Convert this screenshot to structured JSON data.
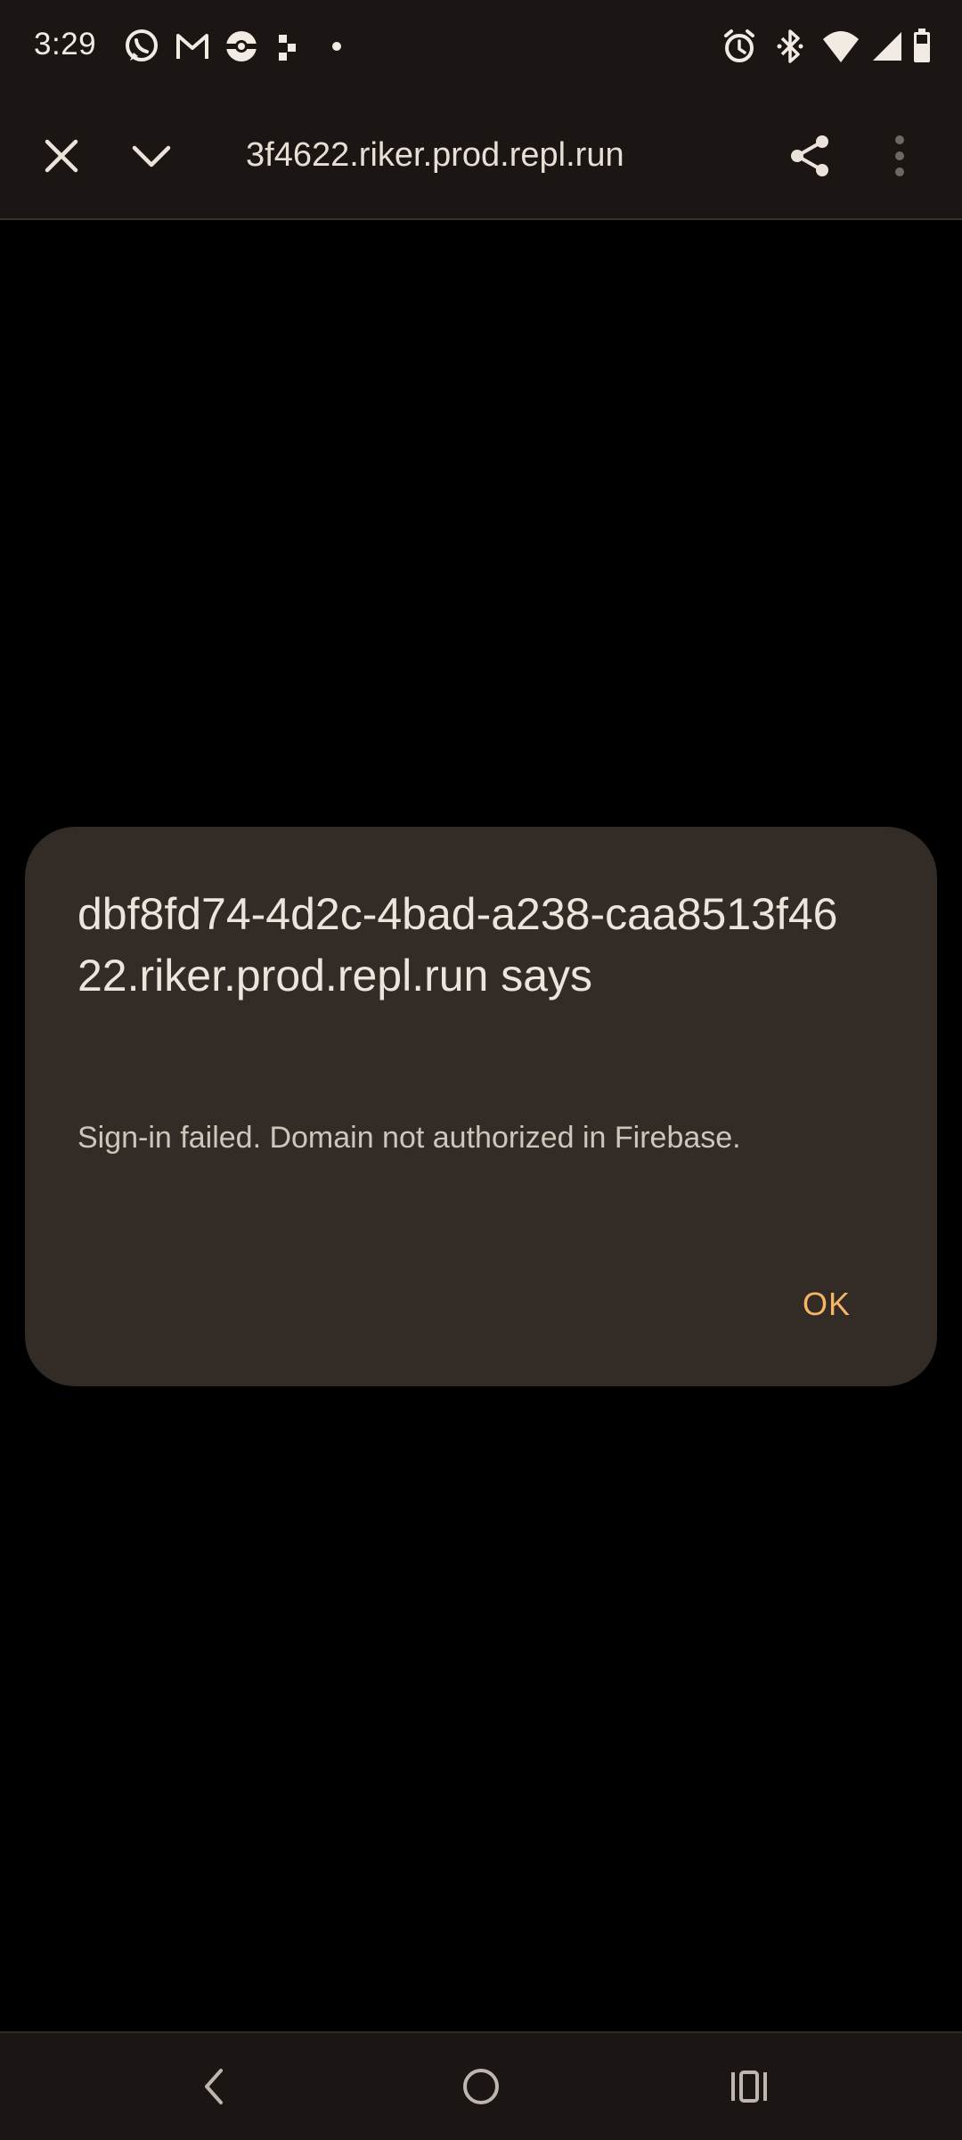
{
  "status_bar": {
    "time": "3:29",
    "left_icons": [
      "whatsapp-icon",
      "gmail-icon",
      "pokeball-icon",
      "dots-app-icon",
      "notification-dot-icon"
    ],
    "right_icons": [
      "alarm-icon",
      "bluetooth-icon",
      "wifi-icon",
      "signal-icon",
      "battery-icon"
    ]
  },
  "toolbar": {
    "url": "3f4622.riker.prod.repl.run",
    "icons": [
      "close-icon",
      "chevron-down-icon",
      "share-icon",
      "more-vert-icon"
    ]
  },
  "dialog": {
    "title": "dbf8fd74-4d2c-4bad-a238-caa8513f4622.riker.prod.repl.run says",
    "message": "Sign-in failed. Domain not authorized in Firebase.",
    "ok_label": "OK"
  },
  "navigation": {
    "icons": [
      "back-icon",
      "home-icon",
      "recents-icon"
    ]
  },
  "colors": {
    "bar_background": "#1b1613",
    "dialog_background": "#322b26",
    "accent": "#f6b465"
  }
}
